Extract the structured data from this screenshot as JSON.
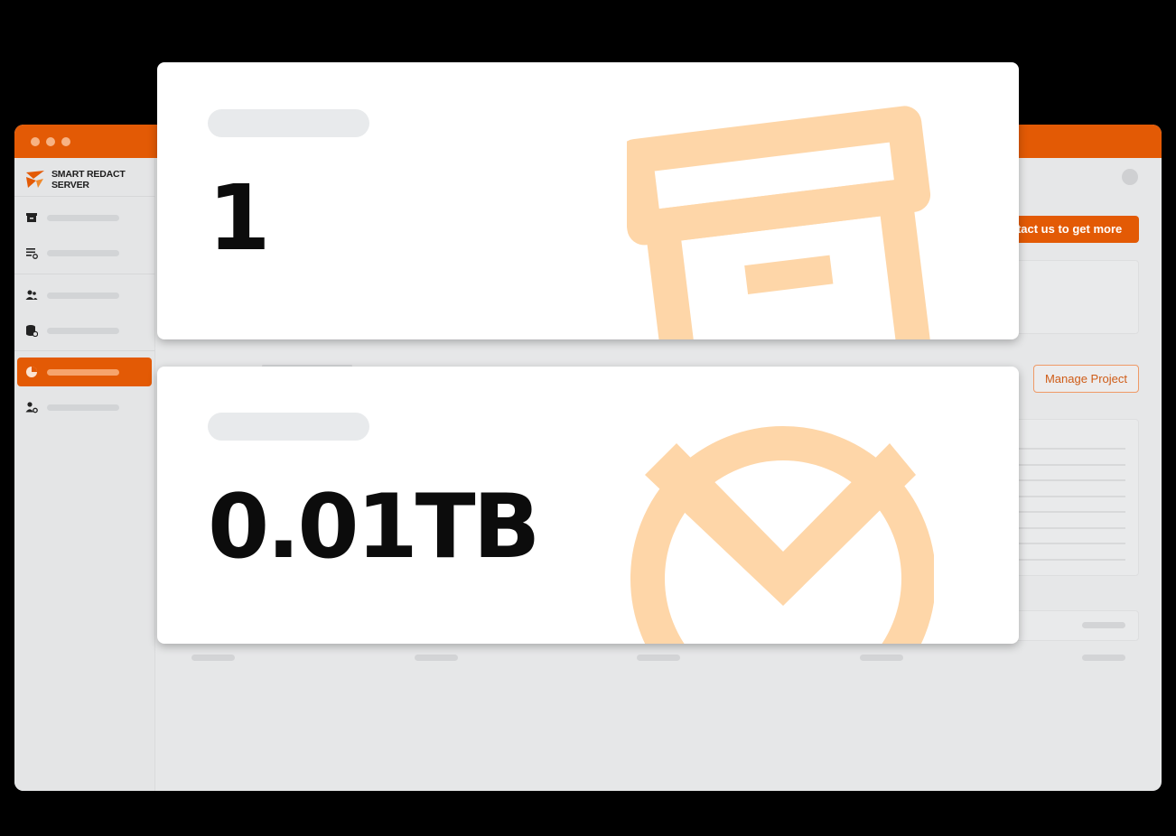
{
  "app": {
    "name": "SMART REDACT SERVER"
  },
  "colors": {
    "accent": "#e35a05",
    "accent_light": "#fed6a8",
    "background": "#000000"
  },
  "header": {
    "contact_label": "ntact us to get more"
  },
  "project": {
    "manage_label": "Manage Project"
  },
  "sidebar": {
    "items": [
      {
        "icon": "archive-icon",
        "active": false
      },
      {
        "icon": "list-settings-icon",
        "active": false
      },
      {
        "icon": "users-icon",
        "active": false
      },
      {
        "icon": "database-settings-icon",
        "active": false
      },
      {
        "icon": "pie-chart-icon",
        "active": true
      },
      {
        "icon": "user-settings-icon",
        "active": false
      }
    ]
  },
  "cards": [
    {
      "value": "1",
      "icon": "archive-box-icon"
    },
    {
      "value": "0.01TB",
      "icon": "storage-pie-icon"
    }
  ]
}
